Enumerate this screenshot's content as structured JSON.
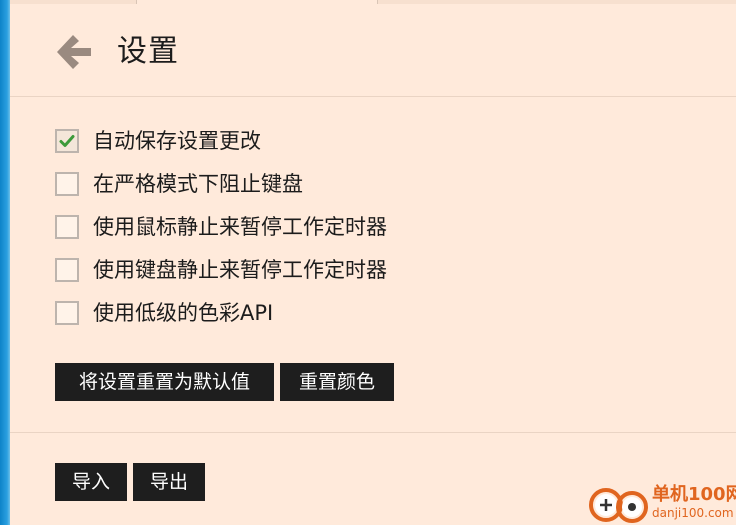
{
  "header": {
    "title": "设置",
    "back_icon": "arrow-left-icon"
  },
  "options": [
    {
      "label": "自动保存设置更改",
      "checked": true
    },
    {
      "label": "在严格模式下阻止键盘",
      "checked": false
    },
    {
      "label": "使用鼠标静止来暂停工作定时器",
      "checked": false
    },
    {
      "label": "使用键盘静止来暂停工作定时器",
      "checked": false
    },
    {
      "label": "使用低级的色彩API",
      "checked": false
    }
  ],
  "buttons": {
    "reset_settings": "将设置重置为默认值",
    "reset_colors": "重置颜色",
    "import": "导入",
    "export": "导出"
  },
  "watermark": {
    "name": "单机100网",
    "url": "danji100.com"
  },
  "colors": {
    "background": "#ffeadb",
    "button": "#1e1e1e",
    "check": "#3c9a3a",
    "accent_edge": "#0d83c8",
    "watermark": "#e0651f"
  }
}
